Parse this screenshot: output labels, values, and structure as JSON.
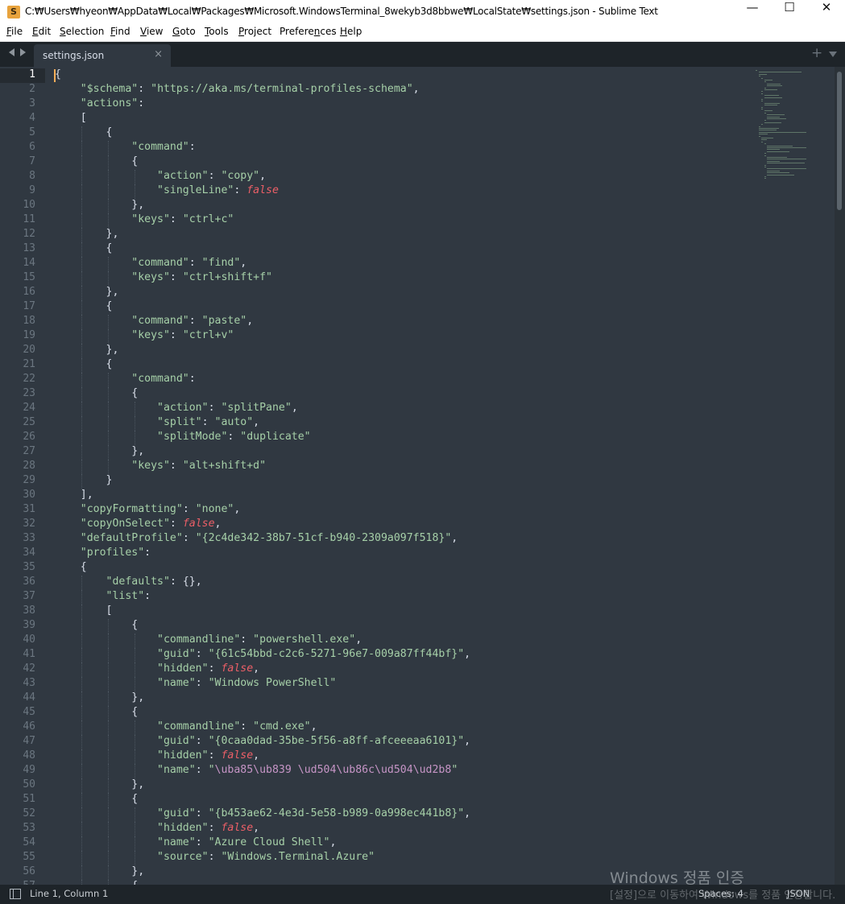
{
  "window": {
    "title": "C:₩Users₩hyeon₩AppData₩Local₩Packages₩Microsoft.WindowsTerminal_8wekyb3d8bbwe₩LocalState₩settings.json - Sublime Text",
    "app_icon": "S",
    "minimize": "—",
    "maximize": "☐",
    "close": "✕"
  },
  "menu": [
    {
      "m": "F",
      "r": "ile"
    },
    {
      "m": "E",
      "r": "dit"
    },
    {
      "m": "S",
      "r": "election"
    },
    {
      "m": "F",
      "r": "ind"
    },
    {
      "m": "V",
      "r": "iew"
    },
    {
      "m": "G",
      "r": "oto"
    },
    {
      "m": "T",
      "r": "ools"
    },
    {
      "m": "P",
      "r": "roject"
    },
    {
      "pre": "Prefere",
      "m": "n",
      "r": "ces"
    },
    {
      "m": "H",
      "r": "elp"
    }
  ],
  "tabs": [
    {
      "label": "settings.json",
      "close": "×"
    }
  ],
  "tabbar": {
    "add": "+"
  },
  "colors": {
    "background": "#303841",
    "caret": "#f9ae58",
    "string": "#a6d0a8",
    "keyword": "#ec5f67",
    "escape": "#c695c6"
  },
  "editor": {
    "current_line": 1,
    "line_numbers": [
      "1",
      "2",
      "3",
      "4",
      "5",
      "6",
      "7",
      "8",
      "9",
      "10",
      "11",
      "12",
      "13",
      "14",
      "15",
      "16",
      "17",
      "18",
      "19",
      "20",
      "21",
      "22",
      "23",
      "24",
      "25",
      "26",
      "27",
      "28",
      "29",
      "30",
      "31",
      "32",
      "33",
      "34",
      "35",
      "36",
      "37",
      "38",
      "39",
      "40",
      "41",
      "42",
      "43",
      "44",
      "45",
      "46",
      "47",
      "48",
      "49",
      "50",
      "51",
      "52",
      "53",
      "54",
      "55",
      "56",
      "57"
    ],
    "lines": [
      [
        [
          "p",
          "{"
        ]
      ],
      [
        [
          "p",
          "    "
        ],
        [
          "key",
          "\"$schema\""
        ],
        [
          "p",
          ": "
        ],
        [
          "str",
          "\"https://aka.ms/terminal-profiles-schema\""
        ],
        [
          "p",
          ","
        ]
      ],
      [
        [
          "p",
          "    "
        ],
        [
          "key",
          "\"actions\""
        ],
        [
          "p",
          ":"
        ]
      ],
      [
        [
          "p",
          "    ["
        ]
      ],
      [
        [
          "p",
          "        {"
        ]
      ],
      [
        [
          "p",
          "            "
        ],
        [
          "key",
          "\"command\""
        ],
        [
          "p",
          ":"
        ]
      ],
      [
        [
          "p",
          "            {"
        ]
      ],
      [
        [
          "p",
          "                "
        ],
        [
          "key",
          "\"action\""
        ],
        [
          "p",
          ": "
        ],
        [
          "str",
          "\"copy\""
        ],
        [
          "p",
          ","
        ]
      ],
      [
        [
          "p",
          "                "
        ],
        [
          "key",
          "\"singleLine\""
        ],
        [
          "p",
          ": "
        ],
        [
          "kw",
          "false"
        ]
      ],
      [
        [
          "p",
          "            },"
        ]
      ],
      [
        [
          "p",
          "            "
        ],
        [
          "key",
          "\"keys\""
        ],
        [
          "p",
          ": "
        ],
        [
          "str",
          "\"ctrl+c\""
        ]
      ],
      [
        [
          "p",
          "        },"
        ]
      ],
      [
        [
          "p",
          "        {"
        ]
      ],
      [
        [
          "p",
          "            "
        ],
        [
          "key",
          "\"command\""
        ],
        [
          "p",
          ": "
        ],
        [
          "str",
          "\"find\""
        ],
        [
          "p",
          ","
        ]
      ],
      [
        [
          "p",
          "            "
        ],
        [
          "key",
          "\"keys\""
        ],
        [
          "p",
          ": "
        ],
        [
          "str",
          "\"ctrl+shift+f\""
        ]
      ],
      [
        [
          "p",
          "        },"
        ]
      ],
      [
        [
          "p",
          "        {"
        ]
      ],
      [
        [
          "p",
          "            "
        ],
        [
          "key",
          "\"command\""
        ],
        [
          "p",
          ": "
        ],
        [
          "str",
          "\"paste\""
        ],
        [
          "p",
          ","
        ]
      ],
      [
        [
          "p",
          "            "
        ],
        [
          "key",
          "\"keys\""
        ],
        [
          "p",
          ": "
        ],
        [
          "str",
          "\"ctrl+v\""
        ]
      ],
      [
        [
          "p",
          "        },"
        ]
      ],
      [
        [
          "p",
          "        {"
        ]
      ],
      [
        [
          "p",
          "            "
        ],
        [
          "key",
          "\"command\""
        ],
        [
          "p",
          ":"
        ]
      ],
      [
        [
          "p",
          "            {"
        ]
      ],
      [
        [
          "p",
          "                "
        ],
        [
          "key",
          "\"action\""
        ],
        [
          "p",
          ": "
        ],
        [
          "str",
          "\"splitPane\""
        ],
        [
          "p",
          ","
        ]
      ],
      [
        [
          "p",
          "                "
        ],
        [
          "key",
          "\"split\""
        ],
        [
          "p",
          ": "
        ],
        [
          "str",
          "\"auto\""
        ],
        [
          "p",
          ","
        ]
      ],
      [
        [
          "p",
          "                "
        ],
        [
          "key",
          "\"splitMode\""
        ],
        [
          "p",
          ": "
        ],
        [
          "str",
          "\"duplicate\""
        ]
      ],
      [
        [
          "p",
          "            },"
        ]
      ],
      [
        [
          "p",
          "            "
        ],
        [
          "key",
          "\"keys\""
        ],
        [
          "p",
          ": "
        ],
        [
          "str",
          "\"alt+shift+d\""
        ]
      ],
      [
        [
          "p",
          "        }"
        ]
      ],
      [
        [
          "p",
          "    ],"
        ]
      ],
      [
        [
          "p",
          "    "
        ],
        [
          "key",
          "\"copyFormatting\""
        ],
        [
          "p",
          ": "
        ],
        [
          "str",
          "\"none\""
        ],
        [
          "p",
          ","
        ]
      ],
      [
        [
          "p",
          "    "
        ],
        [
          "key",
          "\"copyOnSelect\""
        ],
        [
          "p",
          ": "
        ],
        [
          "kw",
          "false"
        ],
        [
          "p",
          ","
        ]
      ],
      [
        [
          "p",
          "    "
        ],
        [
          "key",
          "\"defaultProfile\""
        ],
        [
          "p",
          ": "
        ],
        [
          "str",
          "\"{2c4de342-38b7-51cf-b940-2309a097f518}\""
        ],
        [
          "p",
          ","
        ]
      ],
      [
        [
          "p",
          "    "
        ],
        [
          "key",
          "\"profiles\""
        ],
        [
          "p",
          ":"
        ]
      ],
      [
        [
          "p",
          "    {"
        ]
      ],
      [
        [
          "p",
          "        "
        ],
        [
          "key",
          "\"defaults\""
        ],
        [
          "p",
          ": {},"
        ]
      ],
      [
        [
          "p",
          "        "
        ],
        [
          "key",
          "\"list\""
        ],
        [
          "p",
          ":"
        ]
      ],
      [
        [
          "p",
          "        ["
        ]
      ],
      [
        [
          "p",
          "            {"
        ]
      ],
      [
        [
          "p",
          "                "
        ],
        [
          "key",
          "\"commandline\""
        ],
        [
          "p",
          ": "
        ],
        [
          "str",
          "\"powershell.exe\""
        ],
        [
          "p",
          ","
        ]
      ],
      [
        [
          "p",
          "                "
        ],
        [
          "key",
          "\"guid\""
        ],
        [
          "p",
          ": "
        ],
        [
          "str",
          "\"{61c54bbd-c2c6-5271-96e7-009a87ff44bf}\""
        ],
        [
          "p",
          ","
        ]
      ],
      [
        [
          "p",
          "                "
        ],
        [
          "key",
          "\"hidden\""
        ],
        [
          "p",
          ": "
        ],
        [
          "kw",
          "false"
        ],
        [
          "p",
          ","
        ]
      ],
      [
        [
          "p",
          "                "
        ],
        [
          "key",
          "\"name\""
        ],
        [
          "p",
          ": "
        ],
        [
          "str",
          "\"Windows PowerShell\""
        ]
      ],
      [
        [
          "p",
          "            },"
        ]
      ],
      [
        [
          "p",
          "            {"
        ]
      ],
      [
        [
          "p",
          "                "
        ],
        [
          "key",
          "\"commandline\""
        ],
        [
          "p",
          ": "
        ],
        [
          "str",
          "\"cmd.exe\""
        ],
        [
          "p",
          ","
        ]
      ],
      [
        [
          "p",
          "                "
        ],
        [
          "key",
          "\"guid\""
        ],
        [
          "p",
          ": "
        ],
        [
          "str",
          "\"{0caa0dad-35be-5f56-a8ff-afceeeaa6101}\""
        ],
        [
          "p",
          ","
        ]
      ],
      [
        [
          "p",
          "                "
        ],
        [
          "key",
          "\"hidden\""
        ],
        [
          "p",
          ": "
        ],
        [
          "kw",
          "false"
        ],
        [
          "p",
          ","
        ]
      ],
      [
        [
          "p",
          "                "
        ],
        [
          "key",
          "\"name\""
        ],
        [
          "p",
          ": "
        ],
        [
          "str",
          "\""
        ],
        [
          "esc",
          "\\uba85\\ub839"
        ],
        [
          "str",
          " "
        ],
        [
          "esc",
          "\\ud504\\ub86c\\ud504\\ud2b8"
        ],
        [
          "str",
          "\""
        ]
      ],
      [
        [
          "p",
          "            },"
        ]
      ],
      [
        [
          "p",
          "            {"
        ]
      ],
      [
        [
          "p",
          "                "
        ],
        [
          "key",
          "\"guid\""
        ],
        [
          "p",
          ": "
        ],
        [
          "str",
          "\"{b453ae62-4e3d-5e58-b989-0a998ec441b8}\""
        ],
        [
          "p",
          ","
        ]
      ],
      [
        [
          "p",
          "                "
        ],
        [
          "key",
          "\"hidden\""
        ],
        [
          "p",
          ": "
        ],
        [
          "kw",
          "false"
        ],
        [
          "p",
          ","
        ]
      ],
      [
        [
          "p",
          "                "
        ],
        [
          "key",
          "\"name\""
        ],
        [
          "p",
          ": "
        ],
        [
          "str",
          "\"Azure Cloud Shell\""
        ],
        [
          "p",
          ","
        ]
      ],
      [
        [
          "p",
          "                "
        ],
        [
          "key",
          "\"source\""
        ],
        [
          "p",
          ": "
        ],
        [
          "str",
          "\"Windows.Terminal.Azure\""
        ]
      ],
      [
        [
          "p",
          "            },"
        ]
      ],
      [
        [
          "p",
          "            {"
        ]
      ]
    ]
  },
  "status": {
    "position": "Line 1, Column 1",
    "indentation": "Spaces: 4",
    "syntax": "JSON"
  },
  "watermark": {
    "line1": "Windows 정품 인증",
    "line2": "[설정]으로 이동하여 Windows를 정품 인증합니다."
  }
}
